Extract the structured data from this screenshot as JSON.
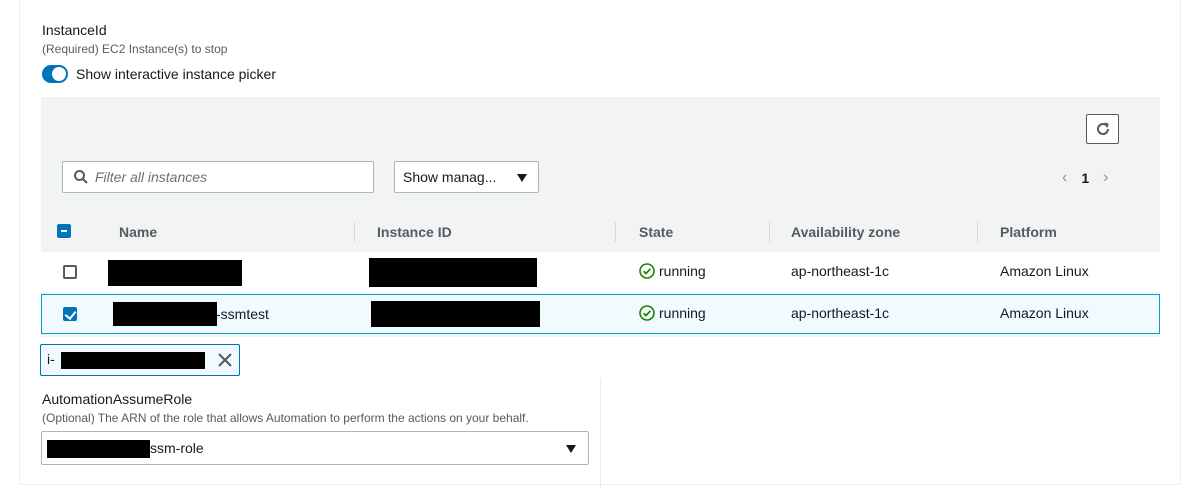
{
  "instance_field": {
    "label": "InstanceId",
    "description": "(Required) EC2 Instance(s) to stop",
    "toggle_label": "Show interactive instance picker",
    "toggle_on": true
  },
  "picker": {
    "filter_placeholder": "Filter all instances",
    "dropdown_value": "Show manag...",
    "pagination": {
      "current_page": "1"
    },
    "columns": [
      "Name",
      "Instance ID",
      "State",
      "Availability zone",
      "Platform"
    ],
    "rows": [
      {
        "name_suffix": "",
        "selected": false,
        "state": "running",
        "az": "ap-northeast-1c",
        "platform": "Amazon Linux"
      },
      {
        "name_suffix": "-ssmtest",
        "selected": true,
        "state": "running",
        "az": "ap-northeast-1c",
        "platform": "Amazon Linux"
      }
    ]
  },
  "selected_token": {
    "prefix": "i-"
  },
  "role_field": {
    "label": "AutomationAssumeRole",
    "description": "(Optional) The ARN of the role that allows Automation to perform the actions on your behalf.",
    "value_suffix": "ssm-role"
  },
  "colors": {
    "accent": "#0073bb",
    "running": "#1d8102",
    "picker_bg": "#f2f3f3",
    "selected_row_bg": "#f1faff"
  }
}
